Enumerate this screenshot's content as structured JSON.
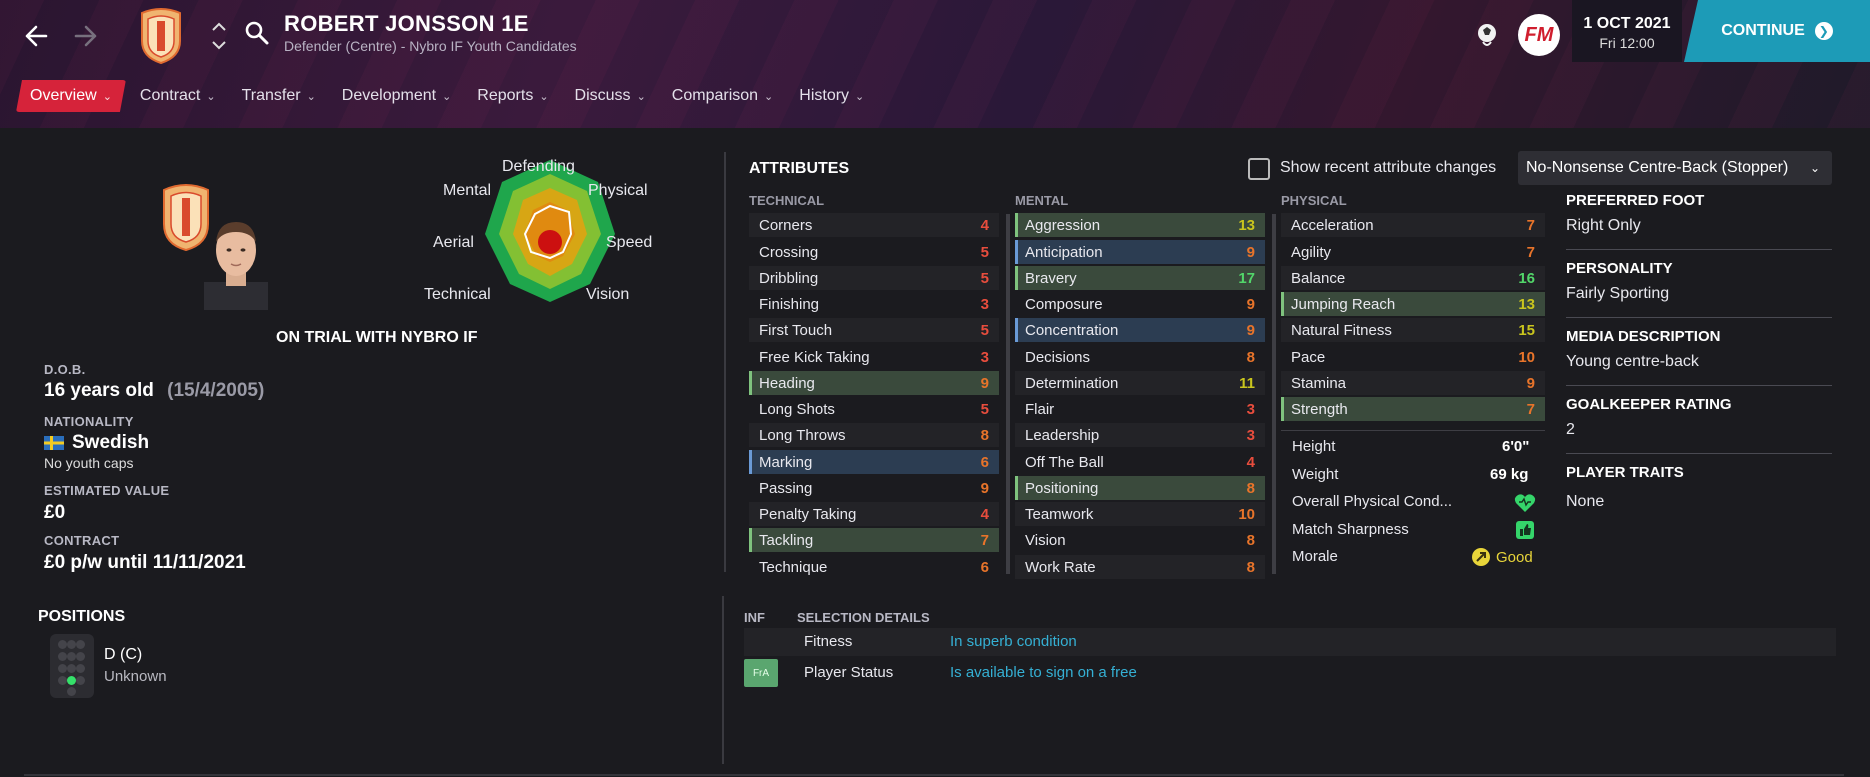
{
  "header": {
    "player_name": "ROBERT JONSSON 1E",
    "player_subtitle": "Defender (Centre) - Nybro IF Youth Candidates",
    "club_crest_text": "NYBRO IF",
    "date": "1 OCT 2021",
    "time": "Fri 12:00",
    "continue_label": "CONTINUE",
    "fm_logo": "FM"
  },
  "tabs": [
    {
      "label": "Overview",
      "active": true
    },
    {
      "label": "Contract"
    },
    {
      "label": "Transfer"
    },
    {
      "label": "Development"
    },
    {
      "label": "Reports"
    },
    {
      "label": "Discuss"
    },
    {
      "label": "Comparison"
    },
    {
      "label": "History"
    }
  ],
  "radar": {
    "labels": {
      "defending": "Defending",
      "physical": "Physical",
      "speed": "Speed",
      "vision": "Vision",
      "technical": "Technical",
      "aerial": "Aerial",
      "mental": "Mental"
    }
  },
  "profile": {
    "trial_text": "ON TRIAL WITH NYBRO IF",
    "dob_label": "D.O.B.",
    "age": "16 years old",
    "dob": "(15/4/2005)",
    "nationality_label": "NATIONALITY",
    "nationality": "Swedish",
    "youth_caps": "No youth caps",
    "value_label": "ESTIMATED VALUE",
    "value": "£0",
    "contract_label": "CONTRACT",
    "contract": "£0 p/w until 11/11/2021"
  },
  "attributes": {
    "title": "ATTRIBUTES",
    "show_changes_label": "Show recent attribute changes",
    "role": "No-Nonsense Centre-Back (Stopper)",
    "technical_header": "TECHNICAL",
    "mental_header": "MENTAL",
    "physical_header": "PHYSICAL",
    "technical": [
      {
        "name": "Corners",
        "value": "4"
      },
      {
        "name": "Crossing",
        "value": "5"
      },
      {
        "name": "Dribbling",
        "value": "5"
      },
      {
        "name": "Finishing",
        "value": "3"
      },
      {
        "name": "First Touch",
        "value": "5"
      },
      {
        "name": "Free Kick Taking",
        "value": "3"
      },
      {
        "name": "Heading",
        "value": "9"
      },
      {
        "name": "Long Shots",
        "value": "5"
      },
      {
        "name": "Long Throws",
        "value": "8"
      },
      {
        "name": "Marking",
        "value": "6"
      },
      {
        "name": "Passing",
        "value": "9"
      },
      {
        "name": "Penalty Taking",
        "value": "4"
      },
      {
        "name": "Tackling",
        "value": "7"
      },
      {
        "name": "Technique",
        "value": "6"
      }
    ],
    "mental": [
      {
        "name": "Aggression",
        "value": "13"
      },
      {
        "name": "Anticipation",
        "value": "9"
      },
      {
        "name": "Bravery",
        "value": "17"
      },
      {
        "name": "Composure",
        "value": "9"
      },
      {
        "name": "Concentration",
        "value": "9"
      },
      {
        "name": "Decisions",
        "value": "8"
      },
      {
        "name": "Determination",
        "value": "11"
      },
      {
        "name": "Flair",
        "value": "3"
      },
      {
        "name": "Leadership",
        "value": "3"
      },
      {
        "name": "Off The Ball",
        "value": "4"
      },
      {
        "name": "Positioning",
        "value": "8"
      },
      {
        "name": "Teamwork",
        "value": "10"
      },
      {
        "name": "Vision",
        "value": "8"
      },
      {
        "name": "Work Rate",
        "value": "8"
      }
    ],
    "physical": [
      {
        "name": "Acceleration",
        "value": "7"
      },
      {
        "name": "Agility",
        "value": "7"
      },
      {
        "name": "Balance",
        "value": "16"
      },
      {
        "name": "Jumping Reach",
        "value": "13"
      },
      {
        "name": "Natural Fitness",
        "value": "15"
      },
      {
        "name": "Pace",
        "value": "10"
      },
      {
        "name": "Stamina",
        "value": "9"
      },
      {
        "name": "Strength",
        "value": "7"
      }
    ],
    "physical_meta": {
      "height_label": "Height",
      "height": "6'0\"",
      "weight_label": "Weight",
      "weight": "69 kg",
      "condition_label": "Overall Physical Cond...",
      "sharpness_label": "Match Sharpness",
      "morale_label": "Morale",
      "morale": "Good"
    }
  },
  "side_info": {
    "foot_label": "PREFERRED FOOT",
    "foot": "Right Only",
    "personality_label": "PERSONALITY",
    "personality": "Fairly Sporting",
    "media_label": "MEDIA DESCRIPTION",
    "media": "Young centre-back",
    "gk_label": "GOALKEEPER RATING",
    "gk": "2",
    "traits_label": "PLAYER TRAITS",
    "traits": "None"
  },
  "positions": {
    "title": "POSITIONS",
    "position": "D (C)",
    "familiarity": "Unknown"
  },
  "selection": {
    "inf_header": "INF",
    "details_header": "SELECTION DETAILS",
    "rows": [
      {
        "label": "Fitness",
        "value": "In superb condition"
      },
      {
        "label": "Player Status",
        "value": "Is available to sign on a free",
        "badge": "FrA"
      }
    ]
  },
  "colors": {
    "accent_red": "#d6233a",
    "continue_teal": "#1d9bb7",
    "link_blue": "#35b0d4",
    "attr_red": "#e84d3d",
    "attr_orange": "#e8742a",
    "attr_yellow": "#c9c51e",
    "attr_green": "#52d66a"
  }
}
